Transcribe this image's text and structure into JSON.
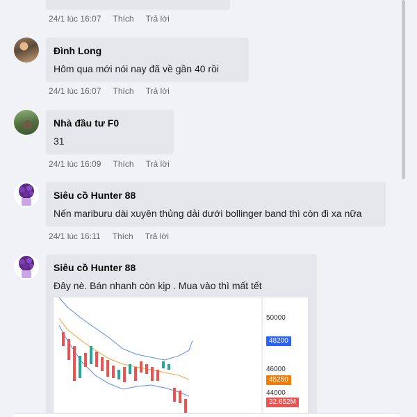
{
  "comments": [
    {
      "author": "",
      "text": "",
      "time": "24/1 lúc 16:07",
      "like": "Thích",
      "reply": "Trả lời"
    },
    {
      "author": "Đình Long",
      "text": "Hôm qua mới nói nay đã về gần 40 rồi",
      "time": "24/1 lúc 16:07",
      "like": "Thích",
      "reply": "Trả lời"
    },
    {
      "author": "Nhà đầu tư F0",
      "text": "31",
      "time": "24/1 lúc 16:09",
      "like": "Thích",
      "reply": "Trả lời"
    },
    {
      "author": "Siêu cồ Hunter 88",
      "text": "Nến mariburu dài xuyên thủng dải dưới bollinger band thì còn đi xa nữa",
      "time": "24/1 lúc 16:11",
      "like": "Thích",
      "reply": "Trả lời"
    },
    {
      "author": "Siêu cồ Hunter 88",
      "text": "Đây nè. Bán nhanh còn kịp . Mua vào thì mất tết"
    }
  ],
  "chart_image": {
    "price_labels": [
      "50000",
      "46000",
      "44000"
    ],
    "tags": [
      {
        "text": "48200",
        "color": "#2962ff"
      },
      {
        "text": "45250",
        "color": "#f57c00"
      },
      {
        "text": "32.652M",
        "color": "#ef5350"
      }
    ]
  }
}
